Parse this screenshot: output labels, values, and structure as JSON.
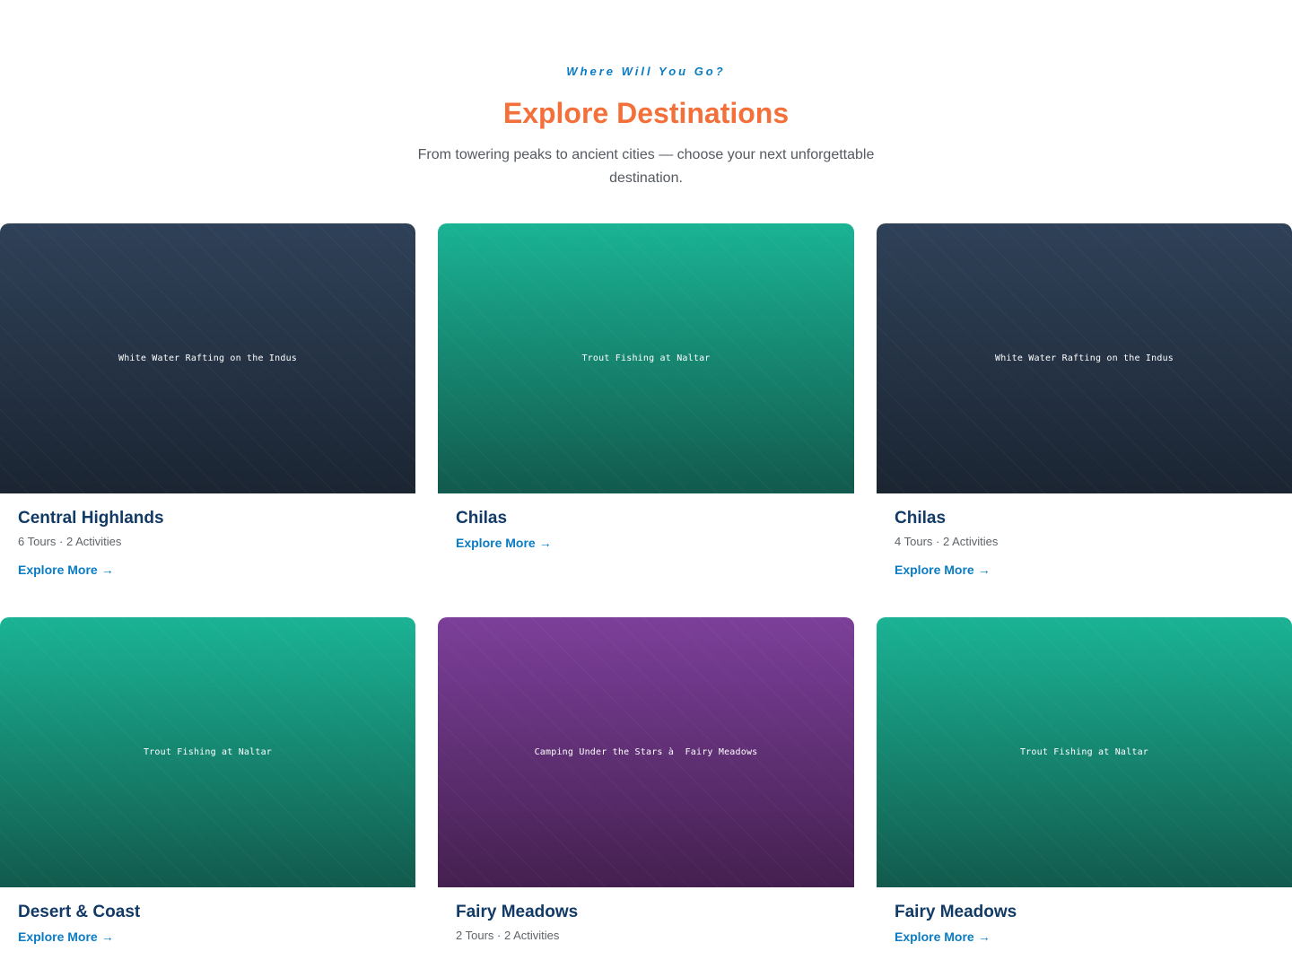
{
  "section": {
    "eyebrow": "Where Will You Go?",
    "title": "Explore Destinations",
    "subtitle": "From towering peaks to ancient cities — choose your next unforgettable destination."
  },
  "colors": {
    "accent_orange": "#f4703a",
    "accent_blue": "#0a7cc4",
    "title_navy": "#123a66"
  },
  "link_arrow": "→",
  "cards": [
    {
      "image_label": "White Water Rafting on the Indus",
      "theme": "dark",
      "title": "Central Highlands",
      "meta": "6 Tours · 2 Activities",
      "link": "Explore More"
    },
    {
      "image_label": "Trout Fishing at Naltar",
      "theme": "teal",
      "title": "Chilas",
      "meta": "",
      "link": "Explore More"
    },
    {
      "image_label": "White Water Rafting on the Indus",
      "theme": "dark",
      "title": "Chilas",
      "meta": "4 Tours · 2 Activities",
      "link": "Explore More"
    },
    {
      "image_label": "Trout Fishing at Naltar",
      "theme": "teal",
      "title": "Desert & Coast",
      "meta": "",
      "link": "Explore More"
    },
    {
      "image_label": "Camping Under the Stars à  Fairy Meadows",
      "theme": "purple",
      "title": "Fairy Meadows",
      "meta": "2 Tours · 2 Activities",
      "link": ""
    },
    {
      "image_label": "Trout Fishing at Naltar",
      "theme": "teal",
      "title": "Fairy Meadows",
      "meta": "",
      "link": "Explore More"
    }
  ]
}
